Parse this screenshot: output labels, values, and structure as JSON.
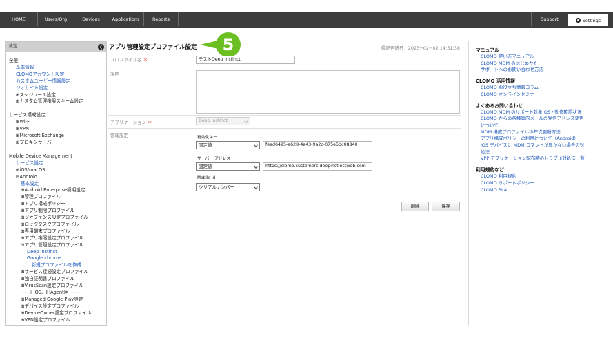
{
  "nav": {
    "items": [
      "HOME",
      "Users/Org",
      "Devices",
      "Applications",
      "Reports"
    ],
    "support": "Support",
    "settings": "Settings"
  },
  "sidebar": {
    "header": "設定",
    "general_heading": "全般",
    "general_items": [
      "基本情報",
      "CLOMOアカウント設定",
      "カスタムユーザー情報設定",
      "ジオサイト設定",
      "⊞スケジュール設定",
      "⊞カスタム管理権限スキーム設定"
    ],
    "service_heading": "サービス構成設定",
    "service_items": [
      "⊞Wi-Fi",
      "⊞VPN",
      "⊞Microsoft Exchange",
      "⊞プロキシサーバー"
    ],
    "mdm_heading": "Mobile Device Management",
    "mdm_service": "サービス設定",
    "ios": "⊞iOS/macOS",
    "android": "⊟Android",
    "android_basic": "基本設定",
    "android_items_a": [
      "⊞Android Enterprise初期設定",
      "⊞管理プロファイル",
      "⊞アプリ構成ポリシー",
      "⊞アプリ制限プロファイル",
      "⊞ジオフェンス設定プロファイル",
      "⊞ロックタスクプロファイル",
      "⊞専用端末プロファイル",
      "⊞アプリ権限設定プロファイル",
      "⊟アプリ管理設定プロファイル"
    ],
    "app_mgmt_children": [
      "Deep Instinct",
      "Google chrome",
      "…新規プロファイルを作成"
    ],
    "android_items_b": [
      "⊞サービス接続設定プロファイル",
      "⊞独自証明書プロファイル",
      "⊞VirusScan設定プロファイル",
      "----- 旧OS、旧Agent用 -----",
      "⊞Managed Google Play設定",
      "⊞デバイス設定プロファイル",
      "⊞DeviceOwner設定プロファイル",
      "⊞VPN設定プロファイル"
    ]
  },
  "main": {
    "title": "アプリ管理設定プロファイル設定",
    "step_badge": "5",
    "last_updated": "最終更新日：2023−02−02 14:51:38",
    "profile_name_label": "プロファイル名",
    "required_mark": "＊",
    "profile_name_value": "テストDeep Instinct",
    "description_label": "説明",
    "application_label": "アプリケーション",
    "application_value": "Deep Instinct",
    "managed_config_label": "管理設定",
    "configs": [
      {
        "key_label": "有効化キー",
        "type": "固定値",
        "value": "fead6495-a628-4a43-9a2c-075e5dc08840"
      },
      {
        "key_label": "サーバー アドレス",
        "type": "固定値",
        "value": "https://clomo.customers.deepinstinctweb.com"
      },
      {
        "key_label": "Mobile id",
        "type": "シリアルナンバー",
        "value": ""
      }
    ],
    "delete_button": "削除",
    "save_button": "保存"
  },
  "right_panel": {
    "sections": [
      {
        "heading": "マニュアル",
        "links": [
          "CLOMO 使い方マニュアル",
          "CLOMO MDM のはじめかた",
          "サポートへのお問い合わせ方法"
        ]
      },
      {
        "heading": "CLOMO 活用情報",
        "links": [
          "CLOMO お役立ち情報コラム",
          "CLOMO オンラインセミナー"
        ]
      },
      {
        "heading": "よくあるお問い合わせ",
        "links": [
          "CLOMO MDM のサポート対象 OS・動作確認状況",
          "CLOMO からの各種案内メールの受信アドレス変更",
          "について",
          "MDM 構成プロファイルの年次更新方法",
          "アプリ構成ポリシーの利用について（Android）",
          "iOS デバイスに MDM コマンドが届かない場合の対",
          "処法",
          "VPP アプリケーション配布時のトラブル対処法一覧"
        ]
      },
      {
        "heading": "利用規約など",
        "links": [
          "CLOMO 利用規約",
          "CLOMO サポートポリシー",
          "CLOMO SLA"
        ]
      }
    ]
  }
}
